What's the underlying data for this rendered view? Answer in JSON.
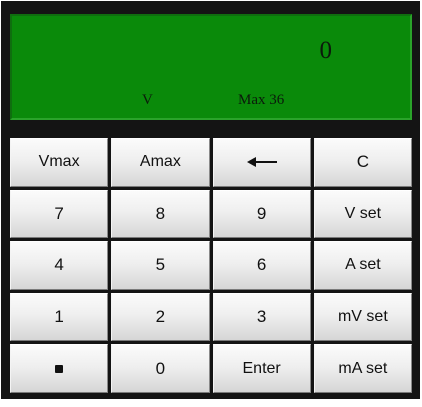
{
  "display": {
    "value": "0",
    "unit": "V",
    "max_label": "Max 36"
  },
  "keys": {
    "vmax": "Vmax",
    "amax": "Amax",
    "backspace_icon": "left-arrow-icon",
    "clear": "C",
    "k7": "7",
    "k8": "8",
    "k9": "9",
    "vset": "V set",
    "k4": "4",
    "k5": "5",
    "k6": "6",
    "aset": "A set",
    "k1": "1",
    "k2": "2",
    "k3": "3",
    "mvset": "mV set",
    "dot_icon": "decimal-point-icon",
    "k0": "0",
    "enter": "Enter",
    "maset": "mA set"
  },
  "colors": {
    "display_bg": "#0a8a0a",
    "frame_bg": "#141414"
  }
}
